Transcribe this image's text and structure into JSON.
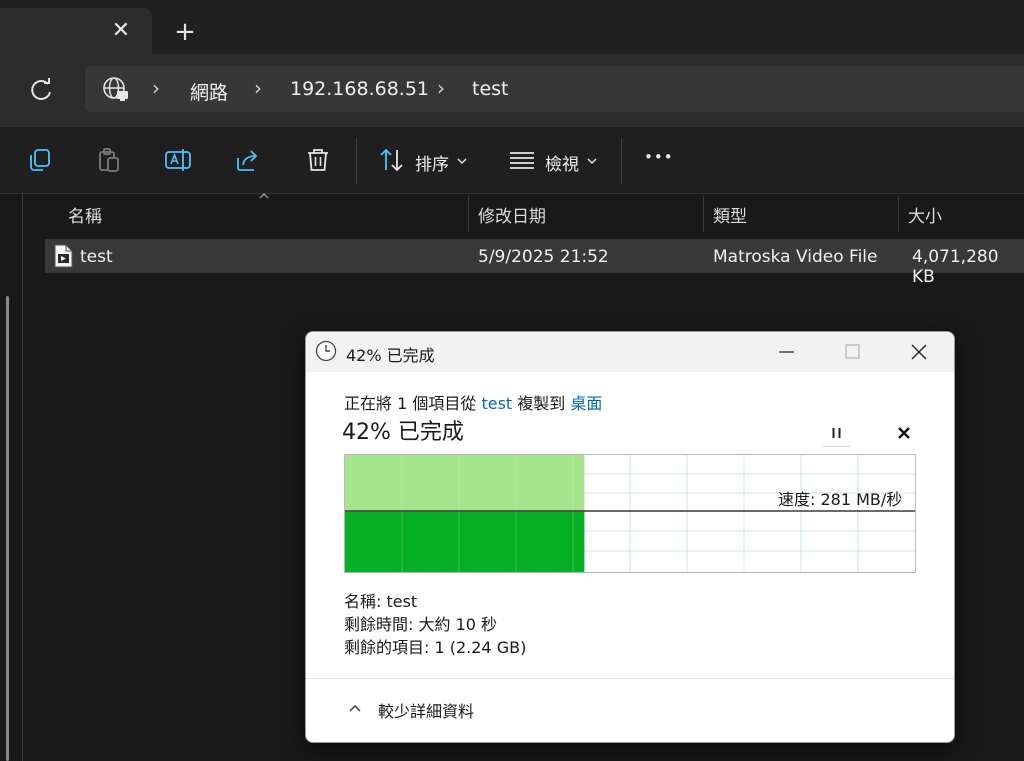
{
  "tabs": {
    "close_glyph": "✕",
    "new_tab_glyph": "+"
  },
  "breadcrumb": {
    "items": [
      "網路",
      "192.168.68.51",
      "test"
    ],
    "separator": "›"
  },
  "toolbar": {
    "sort_label": "排序",
    "view_label": "檢視",
    "more_label": "•••",
    "icons": [
      "copy-icon",
      "paste-icon",
      "rename-icon",
      "share-icon",
      "delete-icon"
    ]
  },
  "file_list": {
    "columns": [
      "名稱",
      "修改日期",
      "類型",
      "大小"
    ],
    "rows": [
      {
        "name": "test",
        "modified": "5/9/2025 21:52",
        "type": "Matroska Video File",
        "size": "4,071,280 KB"
      }
    ]
  },
  "copy_dialog": {
    "title": "42% 已完成",
    "line_prefix": "正在將 1 個項目從 ",
    "source": "test",
    "line_mid": " 複製到 ",
    "destination": "桌面",
    "percent_text": "42% 已完成",
    "progress": 0.42,
    "speed_label": "速度: 281 MB/秒",
    "name_line": "名稱:  test",
    "time_line": "剩餘時間:  大約 10 秒",
    "items_line": "剩餘的項目:  1 (2.24 GB)",
    "less_details": "較少詳細資料",
    "colors": {
      "progress_fill": "#06b025",
      "progress_light": "#a5e58c",
      "link": "#0067c0"
    }
  }
}
